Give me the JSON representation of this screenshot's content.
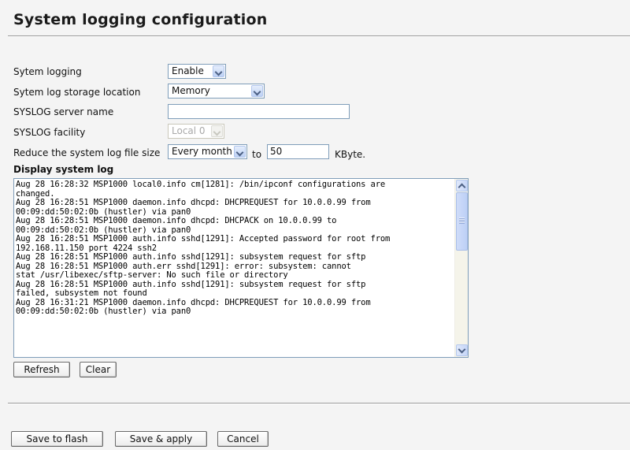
{
  "page": {
    "title": "System logging configuration"
  },
  "form": {
    "system_logging": {
      "label": "Sytem logging",
      "value": "Enable"
    },
    "storage_location": {
      "label": "Sytem log storage location",
      "value": "Memory"
    },
    "syslog_server": {
      "label": "SYSLOG server name",
      "value": ""
    },
    "syslog_facility": {
      "label": "SYSLOG facility",
      "value": "Local 0"
    },
    "reduce": {
      "label": "Reduce the system log file size",
      "period": "Every month",
      "to_label": "to",
      "size": "50",
      "unit": "KByte."
    }
  },
  "log": {
    "section_label": "Display system log",
    "lines": [
      "Aug 28 16:28:32 MSP1000 local0.info cm[1281]: /bin/ipconf configurations are",
      "changed.",
      "Aug 28 16:28:51 MSP1000 daemon.info dhcpd: DHCPREQUEST for 10.0.0.99 from",
      "00:09:dd:50:02:0b (hustler) via pan0",
      "Aug 28 16:28:51 MSP1000 daemon.info dhcpd: DHCPACK on 10.0.0.99 to",
      "00:09:dd:50:02:0b (hustler) via pan0",
      "Aug 28 16:28:51 MSP1000 auth.info sshd[1291]: Accepted password for root from",
      "192.168.11.150 port 4224 ssh2",
      "Aug 28 16:28:51 MSP1000 auth.info sshd[1291]: subsystem request for sftp",
      "Aug 28 16:28:51 MSP1000 auth.err sshd[1291]: error: subsystem: cannot",
      "stat /usr/libexec/sftp-server: No such file or directory",
      "Aug 28 16:28:51 MSP1000 auth.info sshd[1291]: subsystem request for sftp",
      "failed, subsystem not found",
      "Aug 28 16:31:21 MSP1000 daemon.info dhcpd: DHCPREQUEST for 10.0.0.99 from",
      "00:09:dd:50:02:0b (hustler) via pan0"
    ],
    "refresh_label": "Refresh",
    "clear_label": "Clear"
  },
  "actions": {
    "save_flash": "Save to flash",
    "save_apply": "Save & apply",
    "cancel": "Cancel"
  },
  "icons": {
    "dropdown": "chevron-down-icon",
    "scroll_up": "arrow-up-icon",
    "scroll_down": "arrow-down-icon"
  }
}
